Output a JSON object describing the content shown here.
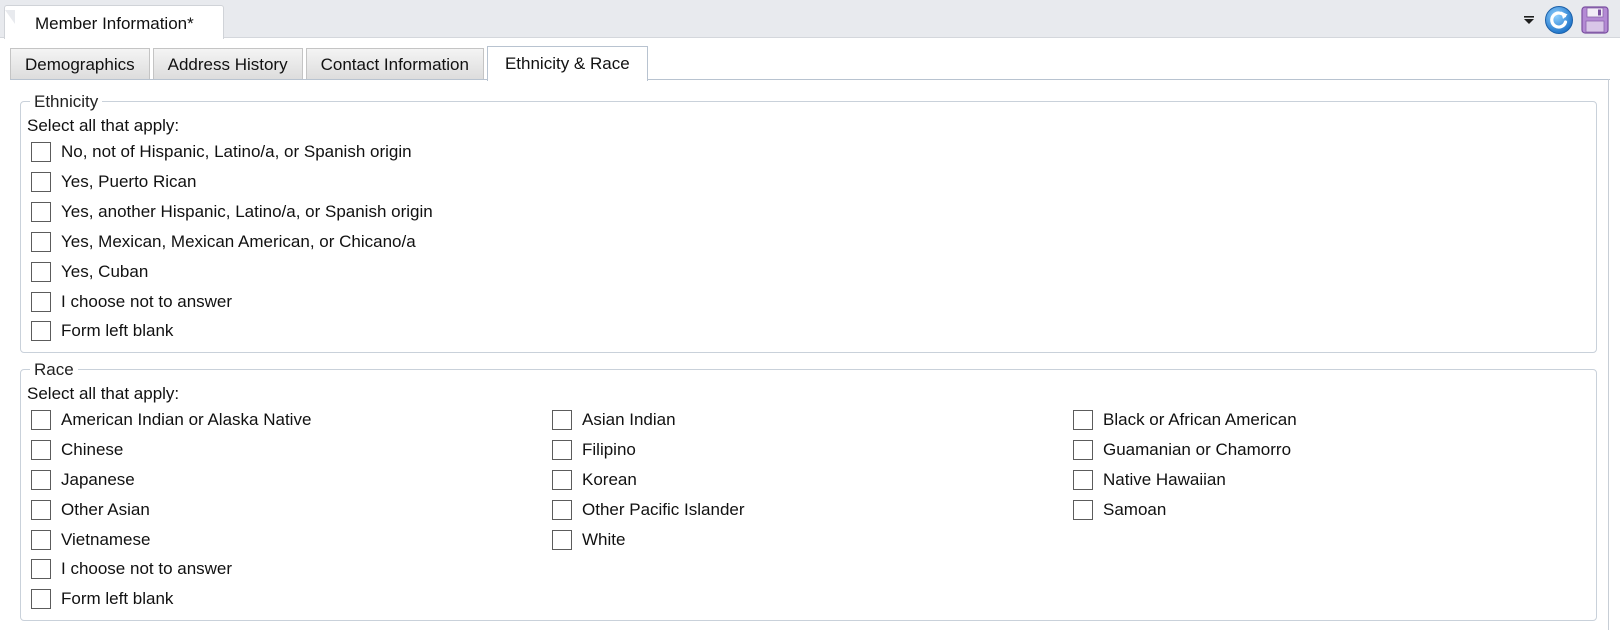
{
  "doc_tab": {
    "title": "Member Information*"
  },
  "tabs": [
    {
      "label": "Demographics",
      "active": false
    },
    {
      "label": "Address History",
      "active": false
    },
    {
      "label": "Contact Information",
      "active": false
    },
    {
      "label": "Ethnicity & Race",
      "active": true
    }
  ],
  "ethnicity": {
    "legend": "Ethnicity",
    "hint": "Select all that apply:",
    "options": [
      {
        "label": "No, not of Hispanic, Latino/a, or Spanish origin",
        "checked": false
      },
      {
        "label": "Yes, Puerto Rican",
        "checked": false
      },
      {
        "label": "Yes, another Hispanic, Latino/a, or Spanish origin",
        "checked": false
      },
      {
        "label": "Yes, Mexican, Mexican American, or Chicano/a",
        "checked": false
      },
      {
        "label": "Yes, Cuban",
        "checked": false
      },
      {
        "label": "I choose not to answer",
        "checked": false
      },
      {
        "label": "Form left blank",
        "checked": false
      }
    ]
  },
  "race": {
    "legend": "Race",
    "hint": "Select all that apply:",
    "columns": [
      [
        {
          "label": "American Indian or Alaska Native",
          "checked": false
        },
        {
          "label": "Chinese",
          "checked": false
        },
        {
          "label": "Japanese",
          "checked": false
        },
        {
          "label": "Other Asian",
          "checked": false
        },
        {
          "label": "Vietnamese",
          "checked": false
        },
        {
          "label": "I choose not to answer",
          "checked": false
        },
        {
          "label": "Form left blank",
          "checked": false
        }
      ],
      [
        {
          "label": "Asian Indian",
          "checked": false
        },
        {
          "label": "Filipino",
          "checked": false
        },
        {
          "label": "Korean",
          "checked": false
        },
        {
          "label": "Other Pacific Islander",
          "checked": false
        },
        {
          "label": "White",
          "checked": false
        }
      ],
      [
        {
          "label": "Black or African American",
          "checked": false
        },
        {
          "label": "Guamanian or Chamorro",
          "checked": false
        },
        {
          "label": "Native Hawaiian",
          "checked": false
        },
        {
          "label": "Samoan",
          "checked": false
        }
      ]
    ]
  },
  "toolbar_icons": [
    "dropdown-arrow-icon",
    "refresh-icon",
    "save-icon"
  ],
  "colors": {
    "refresh": "#2a8fe0",
    "save": "#8a5fb0",
    "tab_border": "#b8c3d0"
  }
}
